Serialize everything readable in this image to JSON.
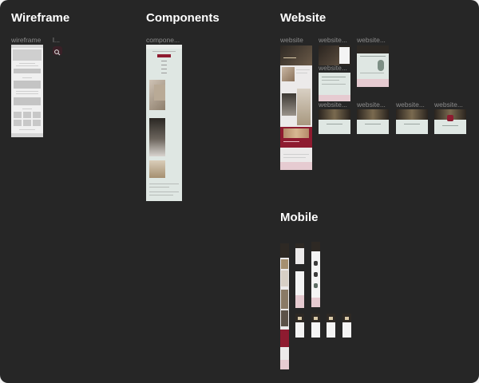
{
  "sections": {
    "wireframe": "Wireframe",
    "components": "Components",
    "website": "Website",
    "mobile": "Mobile"
  },
  "labels": {
    "wireframe": "wireframe",
    "wireframe_second": "l...",
    "components": "compone...",
    "website_1": "website",
    "website_2": "website...",
    "website_3": "website...",
    "website_4": "website...",
    "website_5": "website...",
    "website_6": "website...",
    "website_7": "website...",
    "website_8": "website..."
  },
  "colors": {
    "canvas": "#262626",
    "frame_bg": "#eceaea",
    "mint": "#dfe7e3",
    "pink": "#e6cbd1",
    "wine": "#8e1b30",
    "dark_photo": "#2e2924"
  },
  "icons": {
    "search": "search-icon"
  }
}
